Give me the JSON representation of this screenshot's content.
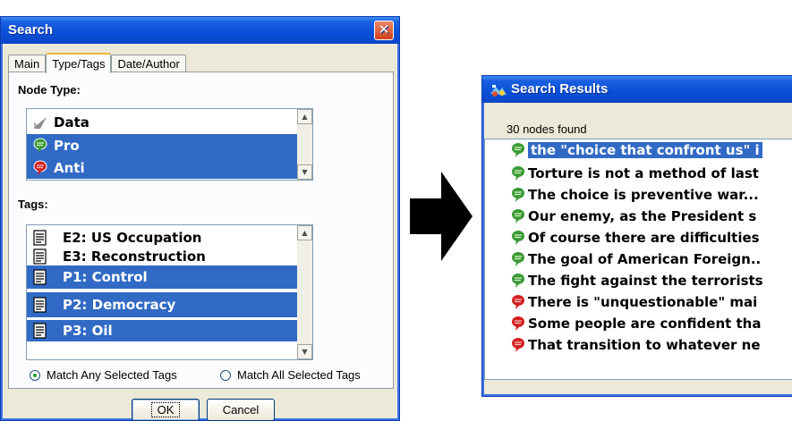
{
  "search_dialog": {
    "title": "Search",
    "close_glyph": "✕",
    "tabs": [
      {
        "label": "Main",
        "active": false
      },
      {
        "label": "Type/Tags",
        "active": true
      },
      {
        "label": "Date/Author",
        "active": false
      }
    ],
    "node_type_label": "Node Type:",
    "node_types": [
      {
        "label": "Data",
        "icon": "data-node-icon",
        "selected": false
      },
      {
        "label": "Pro",
        "icon": "pro-balloon-icon",
        "selected": true
      },
      {
        "label": "Anti",
        "icon": "anti-balloon-icon",
        "selected": true
      }
    ],
    "tags_label": "Tags:",
    "tags": [
      {
        "label": "E2: US Occupation",
        "icon": "tag-document-icon",
        "selected": false
      },
      {
        "label": "E3: Reconstruction",
        "icon": "tag-document-icon",
        "selected": false
      },
      {
        "label": "P1: Control",
        "icon": "tag-document-icon",
        "selected": true
      },
      {
        "label": "P2: Democracy",
        "icon": "tag-document-icon",
        "selected": true
      },
      {
        "label": "P3: Oil",
        "icon": "tag-document-icon",
        "selected": true
      }
    ],
    "match_any_label": "Match Any Selected Tags",
    "match_all_label": "Match All Selected Tags",
    "match_mode": "any",
    "ok_label": "OK",
    "cancel_label": "Cancel"
  },
  "arrow": {
    "icon": "right-arrow-icon"
  },
  "results_window": {
    "title": "Search Results",
    "found_label": "30 nodes found",
    "rows": [
      {
        "text": "the \"choice that confront us\" i",
        "type": "pro",
        "selected": true
      },
      {
        "text": "Torture is not a method of last",
        "type": "pro",
        "selected": false
      },
      {
        "text": "The choice is preventive war...",
        "type": "pro",
        "selected": false
      },
      {
        "text": "Our enemy, as the President s",
        "type": "pro",
        "selected": false
      },
      {
        "text": "Of course there are difficulties",
        "type": "pro",
        "selected": false
      },
      {
        "text": "The goal of American Foreign..",
        "type": "pro",
        "selected": false
      },
      {
        "text": "The fight against the terrorists",
        "type": "pro",
        "selected": false
      },
      {
        "text": "There is \"unquestionable\" mai",
        "type": "anti",
        "selected": false
      },
      {
        "text": "Some people are confident tha",
        "type": "anti",
        "selected": false
      },
      {
        "text": "That transition to whatever ne",
        "type": "anti",
        "selected": false
      }
    ]
  },
  "colors": {
    "selection": "#316ac5",
    "pro_balloon": "#3a9a35",
    "anti_balloon": "#d42020",
    "titlebar": "#0a4fd8",
    "dialog_face": "#ece9d8"
  }
}
